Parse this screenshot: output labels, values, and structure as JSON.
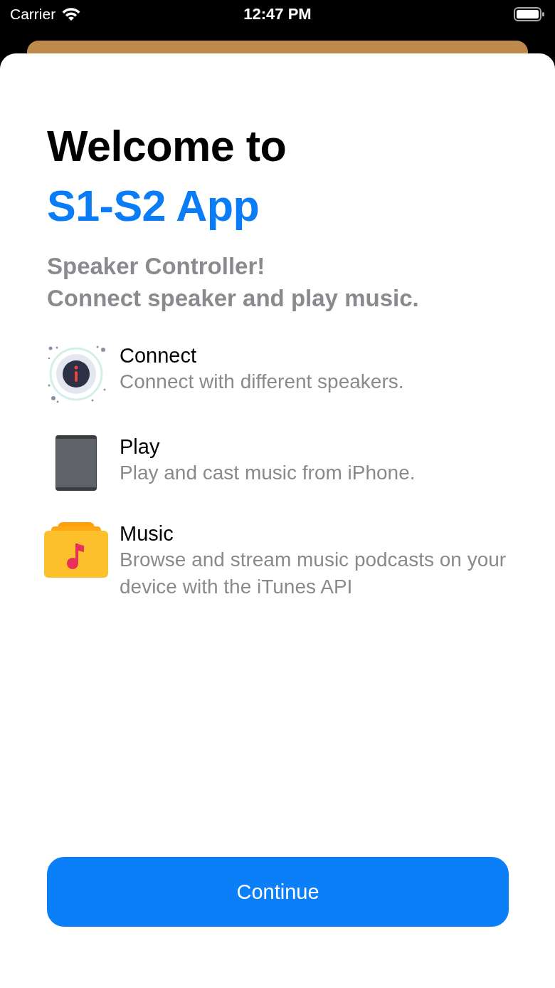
{
  "status_bar": {
    "carrier": "Carrier",
    "time": "12:47 PM"
  },
  "title": {
    "line_1": "Welcome to",
    "line_2": "S1-S2 App"
  },
  "subtitle_lines": [
    "Speaker Controller!",
    "Connect speaker and play music."
  ],
  "features": [
    {
      "kind": "info",
      "title": "Connect",
      "description": "Connect with different speakers."
    },
    {
      "kind": "speaker",
      "title": "Play",
      "description": "Play and cast music from iPhone."
    },
    {
      "kind": "music",
      "title": "Music",
      "description": "Browse and stream music podcasts on your device with the iTunes API"
    }
  ],
  "buttons": [
    {
      "label": "Continue"
    }
  ]
}
